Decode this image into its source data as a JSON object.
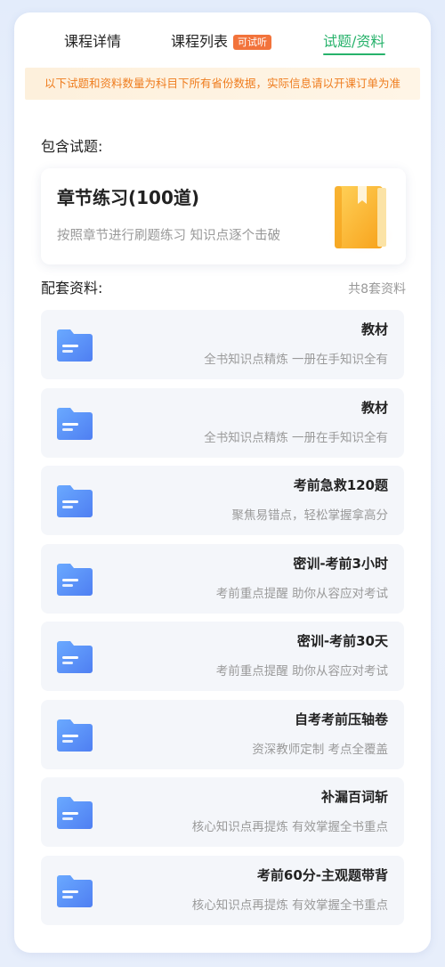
{
  "tabs": [
    {
      "label": "课程详情"
    },
    {
      "label": "课程列表",
      "badge": "可试听"
    },
    {
      "label": "试题/资料",
      "active": true
    }
  ],
  "notice": "以下试题和资料数量为科目下所有省份数据，实际信息请以开课订单为准",
  "questions_section": {
    "title": "包含试题:",
    "card": {
      "title": "章节练习(100道)",
      "description": "按照章节进行刷题练习 知识点逐个击破",
      "icon": "book-icon"
    }
  },
  "materials_section": {
    "title": "配套资料:",
    "count": "共8套资料",
    "items": [
      {
        "title": "教材",
        "description": "全书知识点精炼 一册在手知识全有"
      },
      {
        "title": "教材",
        "description": "全书知识点精炼 一册在手知识全有"
      },
      {
        "title": "考前急救120题",
        "description": "聚焦易错点，轻松掌握拿高分"
      },
      {
        "title": "密训-考前3小时",
        "description": "考前重点提醒 助你从容应对考试"
      },
      {
        "title": "密训-考前30天",
        "description": "考前重点提醒 助你从容应对考试"
      },
      {
        "title": "自考考前压轴卷",
        "description": "资深教师定制 考点全覆盖"
      },
      {
        "title": "补漏百词斩",
        "description": "核心知识点再提炼 有效掌握全书重点"
      },
      {
        "title": "考前60分-主观题带背",
        "description": "核心知识点再提炼 有效掌握全书重点"
      }
    ]
  },
  "colors": {
    "accent_green": "#27b26b",
    "badge_orange": "#f2733b",
    "notice_text": "#ef7d1f"
  }
}
